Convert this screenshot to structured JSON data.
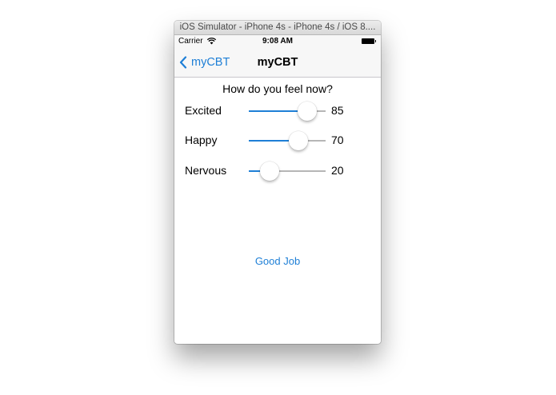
{
  "window": {
    "title": "iOS Simulator - iPhone 4s - iPhone 4s / iOS 8...."
  },
  "status_bar": {
    "carrier": "Carrier",
    "time": "9:08 AM",
    "icons": [
      "wifi-icon",
      "battery-icon"
    ]
  },
  "nav_bar": {
    "back_label": "myCBT",
    "title": "myCBT"
  },
  "content": {
    "question": "How do you feel now?",
    "sliders": [
      {
        "label": "Excited",
        "value": "85",
        "level": 0.85
      },
      {
        "label": "Happy",
        "value": "70",
        "level": 0.7
      },
      {
        "label": "Nervous",
        "value": "20",
        "level": 0.2
      }
    ],
    "button_label": "Good Job"
  },
  "colors": {
    "accent": "#1e7fd6",
    "track": "#b6b6b6"
  }
}
